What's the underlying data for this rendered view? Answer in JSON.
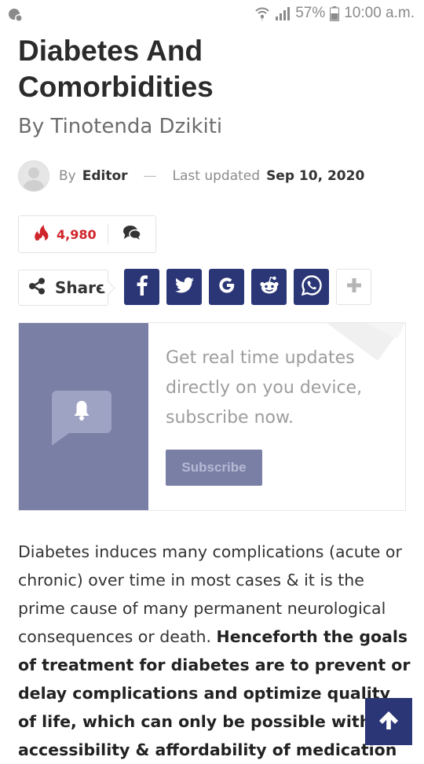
{
  "status_bar": {
    "battery": "57%",
    "time": "10:00 a.m."
  },
  "article": {
    "title_line1": "Diabetes And",
    "title_line2": "Comorbidities",
    "byline": "By Tinotenda Dzikiti",
    "meta": {
      "by_label": "By",
      "author": "Editor",
      "separator": "—",
      "updated_label": "Last updated",
      "updated_date": "Sep 10, 2020"
    },
    "views_count": "4,980",
    "body_plain": "Diabetes induces many complications (acute or chronic) over time in most cases & it is the prime cause of many permanent neurological consequences or death. ",
    "body_bold": "Henceforth the goals of treatment for diabetes are to prevent or delay complications and optimize quality of life, which can only be possible with the accessibility & affordability of medication"
  },
  "share": {
    "label": "Share",
    "networks": [
      "facebook-icon",
      "twitter-icon",
      "google-icon",
      "reddit-icon",
      "whatsapp-icon",
      "plus-icon"
    ]
  },
  "subscribe": {
    "text": "Get real time updates directly on you device, subscribe now.",
    "button_label": "Subscribe"
  },
  "colors": {
    "brand": "#2b3676",
    "subscribe_panel": "#7a7fa6",
    "views_red": "#d0242b"
  }
}
